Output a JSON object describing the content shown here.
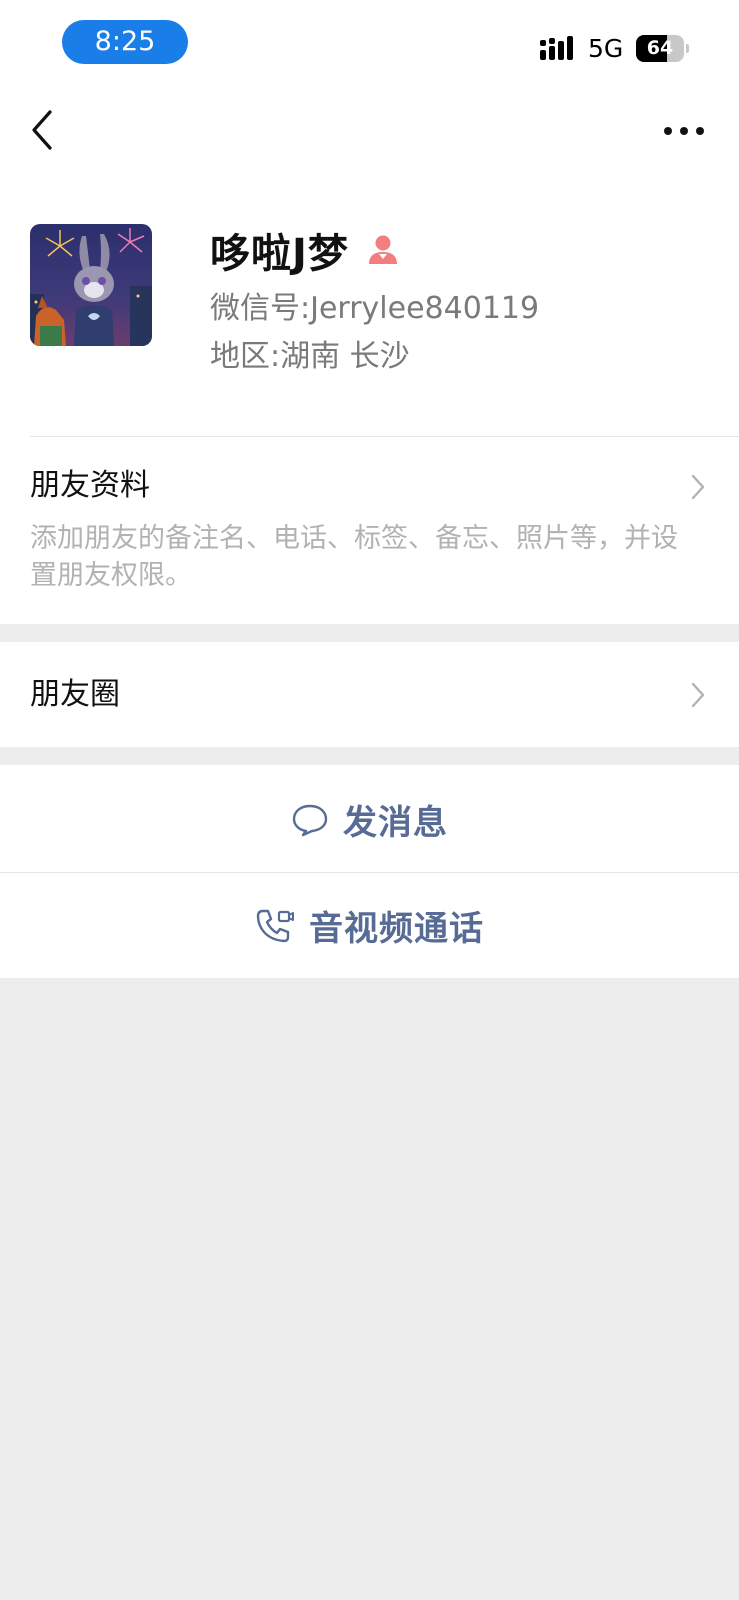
{
  "status_bar": {
    "time": "8:25",
    "network": "5G",
    "battery": "64",
    "battery_level_percent": 64
  },
  "header": {
    "back_icon": "chevron-left-icon",
    "more_icon": "more-horizontal-icon"
  },
  "profile": {
    "name": "哆啦J梦",
    "gender_icon": "female-user-icon",
    "wechat_id": "微信号:Jerrylee840119",
    "region": "地区:湖南 长沙"
  },
  "friend_info": {
    "title": "朋友资料",
    "description": "添加朋友的备注名、电话、标签、备忘、照片等，并设置朋友权限。"
  },
  "moments": {
    "title": "朋友圈"
  },
  "actions": {
    "message_label": "发消息",
    "call_label": "音视频通话"
  },
  "colors": {
    "status_pill": "#1a7ee8",
    "link_blue": "#576b95",
    "female_icon": "#f37e7d",
    "background": "#ededed"
  }
}
